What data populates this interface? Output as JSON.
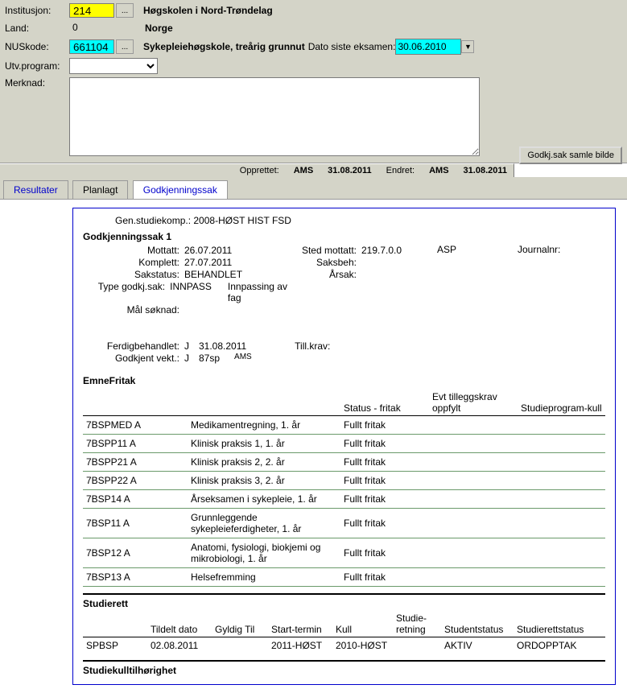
{
  "header": {
    "institusjon_label": "Institusjon:",
    "institusjon_value": "214",
    "institusjon_name": "Høgskolen i Nord-Trøndelag",
    "land_label": "Land:",
    "land_value": "0",
    "land_name": "Norge",
    "nuskode_label": "NUSkode:",
    "nuskode_value": "661104",
    "nuskode_name": "Sykepleiehøgskole, treårig grunnut",
    "dato_siste_label": "Dato siste eksamen:",
    "dato_siste_value": "30.06.2010",
    "utvprogram_label": "Utv.program:",
    "merknad_label": "Merknad:",
    "opprettet_label": "Opprettet:",
    "opprettet_by": "AMS",
    "opprettet_date": "31.08.2011",
    "endret_label": "Endret:",
    "endret_by": "AMS",
    "endret_date": "31.08.2011",
    "godkj_button": "Godkj.sak samle bilde"
  },
  "tabs": {
    "resultater": "Resultater",
    "planlagt": "Planlagt",
    "godkjenningssak": "Godkjenningssak"
  },
  "content": {
    "gen_line": "Gen.studiekomp.: 2008-HØST HIST FSD",
    "case_title": "Godkjenningssak 1",
    "mottatt_label": "Mottatt:",
    "mottatt_value": "26.07.2011",
    "komplett_label": "Komplett:",
    "komplett_value": "27.07.2011",
    "sakstatus_label": "Sakstatus:",
    "sakstatus_value": "BEHANDLET",
    "type_label": "Type godkj.sak:",
    "type_value": "INNPASS",
    "type_desc": "Innpassing av fag",
    "mal_label": "Mål søknad:",
    "sted_label": "Sted mottatt:",
    "sted_value": "219.7.0.0",
    "saksbeh_label": "Saksbeh:",
    "arsak_label": "Årsak:",
    "asp": "ASP",
    "journalnr_label": "Journalnr:",
    "ferdig_label": "Ferdigbehandlet:",
    "ferdig_j": "J",
    "ferdig_date": "31.08.2011",
    "tillkrav_label": "Till.krav:",
    "godkvekt_label": "Godkjent vekt.:",
    "godkvekt_j": "J",
    "godkvekt_sp": "87sp",
    "godkvekt_by": "AMS",
    "emnefritak_title": "EmneFritak",
    "emnefritak_headers": {
      "status": "Status - fritak",
      "evt": "Evt tilleggskrav oppfylt",
      "studieprogram": "Studieprogram-kull"
    },
    "emnefritak_rows": [
      {
        "code": "7BSPMED A",
        "name": "Medikamentregning, 1. år",
        "status": "Fullt fritak"
      },
      {
        "code": "7BSPP11 A",
        "name": "Klinisk praksis 1, 1. år",
        "status": "Fullt fritak"
      },
      {
        "code": "7BSPP21 A",
        "name": "Klinisk praksis 2, 2. år",
        "status": "Fullt fritak"
      },
      {
        "code": "7BSPP22 A",
        "name": "Klinisk praksis 3, 2. år",
        "status": "Fullt fritak"
      },
      {
        "code": "7BSP14 A",
        "name": "Årseksamen i sykepleie, 1. år",
        "status": "Fullt fritak"
      },
      {
        "code": "7BSP11 A",
        "name": "Grunnleggende sykepleieferdigheter, 1. år",
        "status": "Fullt fritak"
      },
      {
        "code": "7BSP12 A",
        "name": "Anatomi, fysiologi, biokjemi og mikrobiologi, 1. år",
        "status": "Fullt fritak"
      },
      {
        "code": "7BSP13 A",
        "name": "Helsefremming",
        "status": "Fullt fritak"
      }
    ],
    "studierett_title": "Studierett",
    "studierett_headers": {
      "tildelt": "Tildelt dato",
      "gyldig": "Gyldig Til",
      "start": "Start-termin",
      "kull": "Kull",
      "retning": "Studie-\nretning",
      "studentstatus": "Studentstatus",
      "studierettstatus": "Studierettstatus"
    },
    "studierett_rows": [
      {
        "code": "SPBSP",
        "tildelt": "02.08.2011",
        "gyldig": "",
        "start": "2011-HØST",
        "kull": "2010-HØST",
        "retning": "",
        "studentstatus": "AKTIV",
        "studierettstatus": "ORDOPPTAK"
      }
    ],
    "studiekull_title": "Studiekulltilhørighet"
  }
}
